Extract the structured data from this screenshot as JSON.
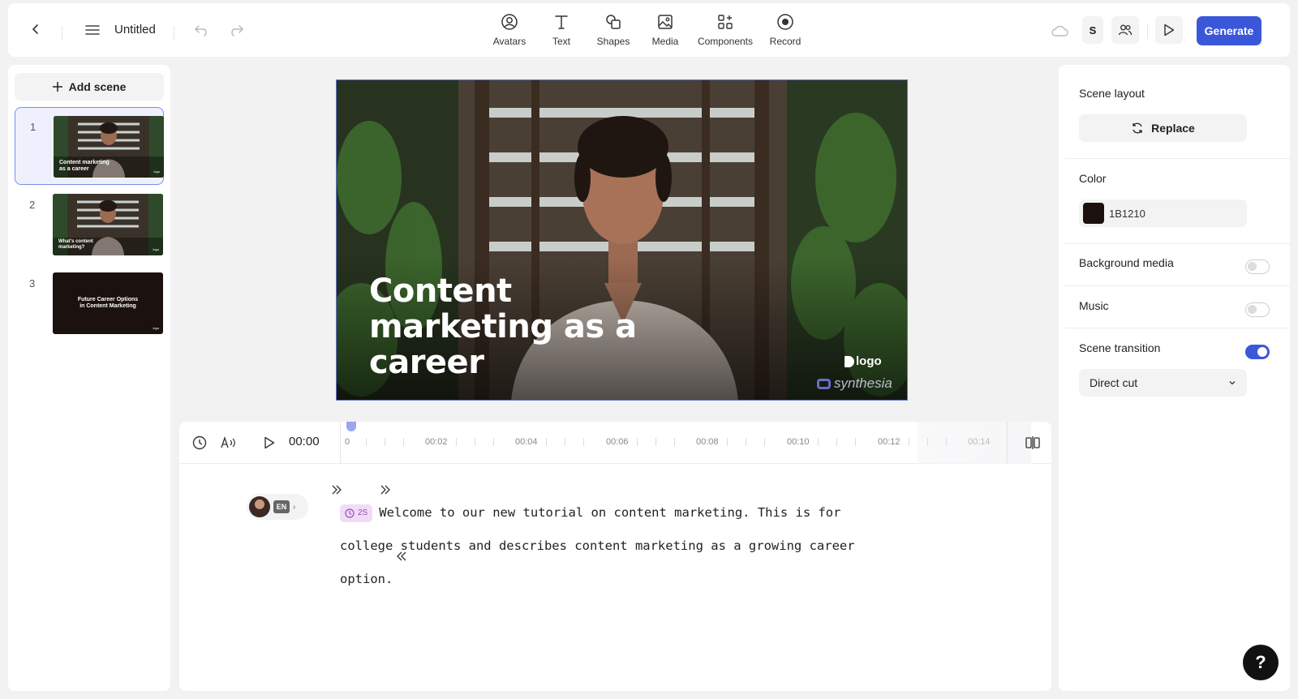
{
  "header": {
    "title": "Untitled",
    "tools": [
      {
        "label": "Avatars"
      },
      {
        "label": "Text"
      },
      {
        "label": "Shapes"
      },
      {
        "label": "Media"
      },
      {
        "label": "Components"
      },
      {
        "label": "Record"
      }
    ],
    "user_initial": "S",
    "generate_label": "Generate"
  },
  "scenes": {
    "add_label": "Add scene",
    "items": [
      {
        "number": "1",
        "thumb_text": "Content marketing as a career",
        "thumb_logo": "logo"
      },
      {
        "number": "2",
        "thumb_text": "What's content marketing?",
        "thumb_logo": "logo"
      },
      {
        "number": "3",
        "thumb_text": "Future Career Options in Content Marketing",
        "thumb_logo": "logo"
      }
    ]
  },
  "canvas": {
    "title": "Content marketing as a career",
    "logo_text": "logo",
    "watermark": "synthesia"
  },
  "timeline": {
    "current_time": "00:00",
    "ticks": [
      "0",
      "00:02",
      "00:04",
      "00:06",
      "00:08",
      "00:10",
      "00:12",
      "00:14"
    ]
  },
  "script": {
    "language": "EN",
    "pause": "2S",
    "line1": "Welcome to our new tutorial on content marketing. This is for",
    "line2": "college students and describes content marketing as a growing career",
    "line3": "option."
  },
  "right_panel": {
    "scene_layout_label": "Scene layout",
    "replace_label": "Replace",
    "color_label": "Color",
    "color_value": "1B1210",
    "background_media_label": "Background media",
    "background_media_on": false,
    "music_label": "Music",
    "music_on": false,
    "transition_label": "Scene transition",
    "transition_on": true,
    "transition_value": "Direct cut"
  },
  "help_label": "?"
}
